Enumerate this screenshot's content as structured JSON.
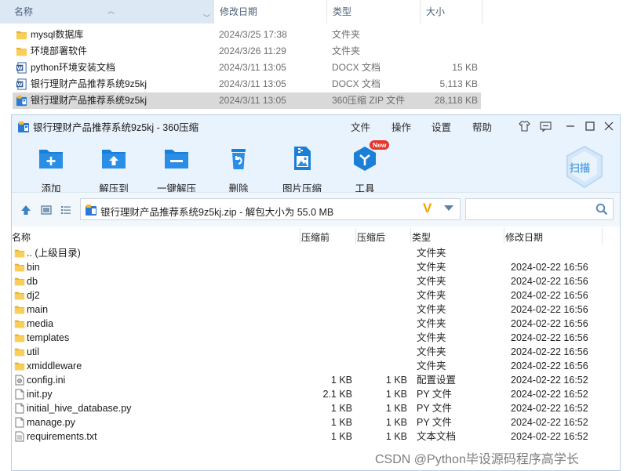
{
  "explorer": {
    "columns": {
      "name": "名称",
      "date": "修改日期",
      "type": "类型",
      "size": "大小"
    },
    "rows": [
      {
        "name": "mysql数据库",
        "date": "2024/3/25 17:38",
        "type": "文件夹",
        "size": "",
        "icon": "folder-icon"
      },
      {
        "name": "环境部署软件",
        "date": "2024/3/26 11:29",
        "type": "文件夹",
        "size": "",
        "icon": "folder-icon"
      },
      {
        "name": "python环境安装文档",
        "date": "2024/3/11 13:05",
        "type": "DOCX 文档",
        "size": "15 KB",
        "icon": "word-doc-icon"
      },
      {
        "name": "银行理财产品推荐系统9z5kj",
        "date": "2024/3/11 13:05",
        "type": "DOCX 文档",
        "size": "5,113 KB",
        "icon": "word-doc-icon"
      },
      {
        "name": "银行理财产品推荐系统9z5kj",
        "date": "2024/3/11 13:05",
        "type": "360压缩 ZIP 文件",
        "size": "28,118 KB",
        "icon": "zip-archive-icon",
        "selected": true
      }
    ]
  },
  "zip_window": {
    "title": "银行理财产品推荐系统9z5kj - 360压缩",
    "menu": [
      "文件",
      "操作",
      "设置",
      "帮助"
    ],
    "toolbar": [
      {
        "label": "添加",
        "icon": "add-icon"
      },
      {
        "label": "解压到",
        "icon": "extract-to-icon"
      },
      {
        "label": "一键解压",
        "icon": "one-click-extract-icon"
      },
      {
        "label": "删除",
        "icon": "delete-icon"
      },
      {
        "label": "图片压缩",
        "icon": "image-compress-icon"
      },
      {
        "label": "工具",
        "icon": "tools-icon",
        "badge": "New"
      }
    ],
    "scan_label": "扫描",
    "address": "银行理财产品推荐系统9z5kj.zip - 解包大小为 55.0 MB",
    "address_badge": "V",
    "search_placeholder": "",
    "list_columns": {
      "name": "名称",
      "compressed": "压缩前",
      "original": "压缩后",
      "type": "类型",
      "date": "修改日期"
    },
    "rows": [
      {
        "name": ".. (上级目录)",
        "compressed": "",
        "original": "",
        "type": "文件夹",
        "date": "",
        "icon": "folder-icon"
      },
      {
        "name": "bin",
        "compressed": "",
        "original": "",
        "type": "文件夹",
        "date": "2024-02-22 16:56",
        "icon": "folder-icon"
      },
      {
        "name": "db",
        "compressed": "",
        "original": "",
        "type": "文件夹",
        "date": "2024-02-22 16:56",
        "icon": "folder-icon"
      },
      {
        "name": "dj2",
        "compressed": "",
        "original": "",
        "type": "文件夹",
        "date": "2024-02-22 16:56",
        "icon": "folder-icon"
      },
      {
        "name": "main",
        "compressed": "",
        "original": "",
        "type": "文件夹",
        "date": "2024-02-22 16:56",
        "icon": "folder-icon"
      },
      {
        "name": "media",
        "compressed": "",
        "original": "",
        "type": "文件夹",
        "date": "2024-02-22 16:56",
        "icon": "folder-icon"
      },
      {
        "name": "templates",
        "compressed": "",
        "original": "",
        "type": "文件夹",
        "date": "2024-02-22 16:56",
        "icon": "folder-icon"
      },
      {
        "name": "util",
        "compressed": "",
        "original": "",
        "type": "文件夹",
        "date": "2024-02-22 16:56",
        "icon": "folder-icon"
      },
      {
        "name": "xmiddleware",
        "compressed": "",
        "original": "",
        "type": "文件夹",
        "date": "2024-02-22 16:56",
        "icon": "folder-icon"
      },
      {
        "name": "config.ini",
        "compressed": "1 KB",
        "original": "1 KB",
        "type": "配置设置",
        "date": "2024-02-22 16:52",
        "icon": "config-file-icon"
      },
      {
        "name": "init.py",
        "compressed": "2.1 KB",
        "original": "1 KB",
        "type": "PY 文件",
        "date": "2024-02-22 16:52",
        "icon": "file-icon"
      },
      {
        "name": "initial_hive_database.py",
        "compressed": "1 KB",
        "original": "1 KB",
        "type": "PY 文件",
        "date": "2024-02-22 16:52",
        "icon": "file-icon"
      },
      {
        "name": "manage.py",
        "compressed": "1 KB",
        "original": "1 KB",
        "type": "PY 文件",
        "date": "2024-02-22 16:52",
        "icon": "file-icon"
      },
      {
        "name": "requirements.txt",
        "compressed": "1 KB",
        "original": "1 KB",
        "type": "文本文档",
        "date": "2024-02-22 16:52",
        "icon": "text-file-icon"
      }
    ]
  },
  "watermark": "CSDN @Python毕设源码程序高学长",
  "colors": {
    "folder": "#f5c443",
    "accent_blue": "#1a7fd6",
    "selection_gray": "#d9d9d9",
    "header_blue": "#dde8f5",
    "window_bg": "#e9f3fd"
  }
}
